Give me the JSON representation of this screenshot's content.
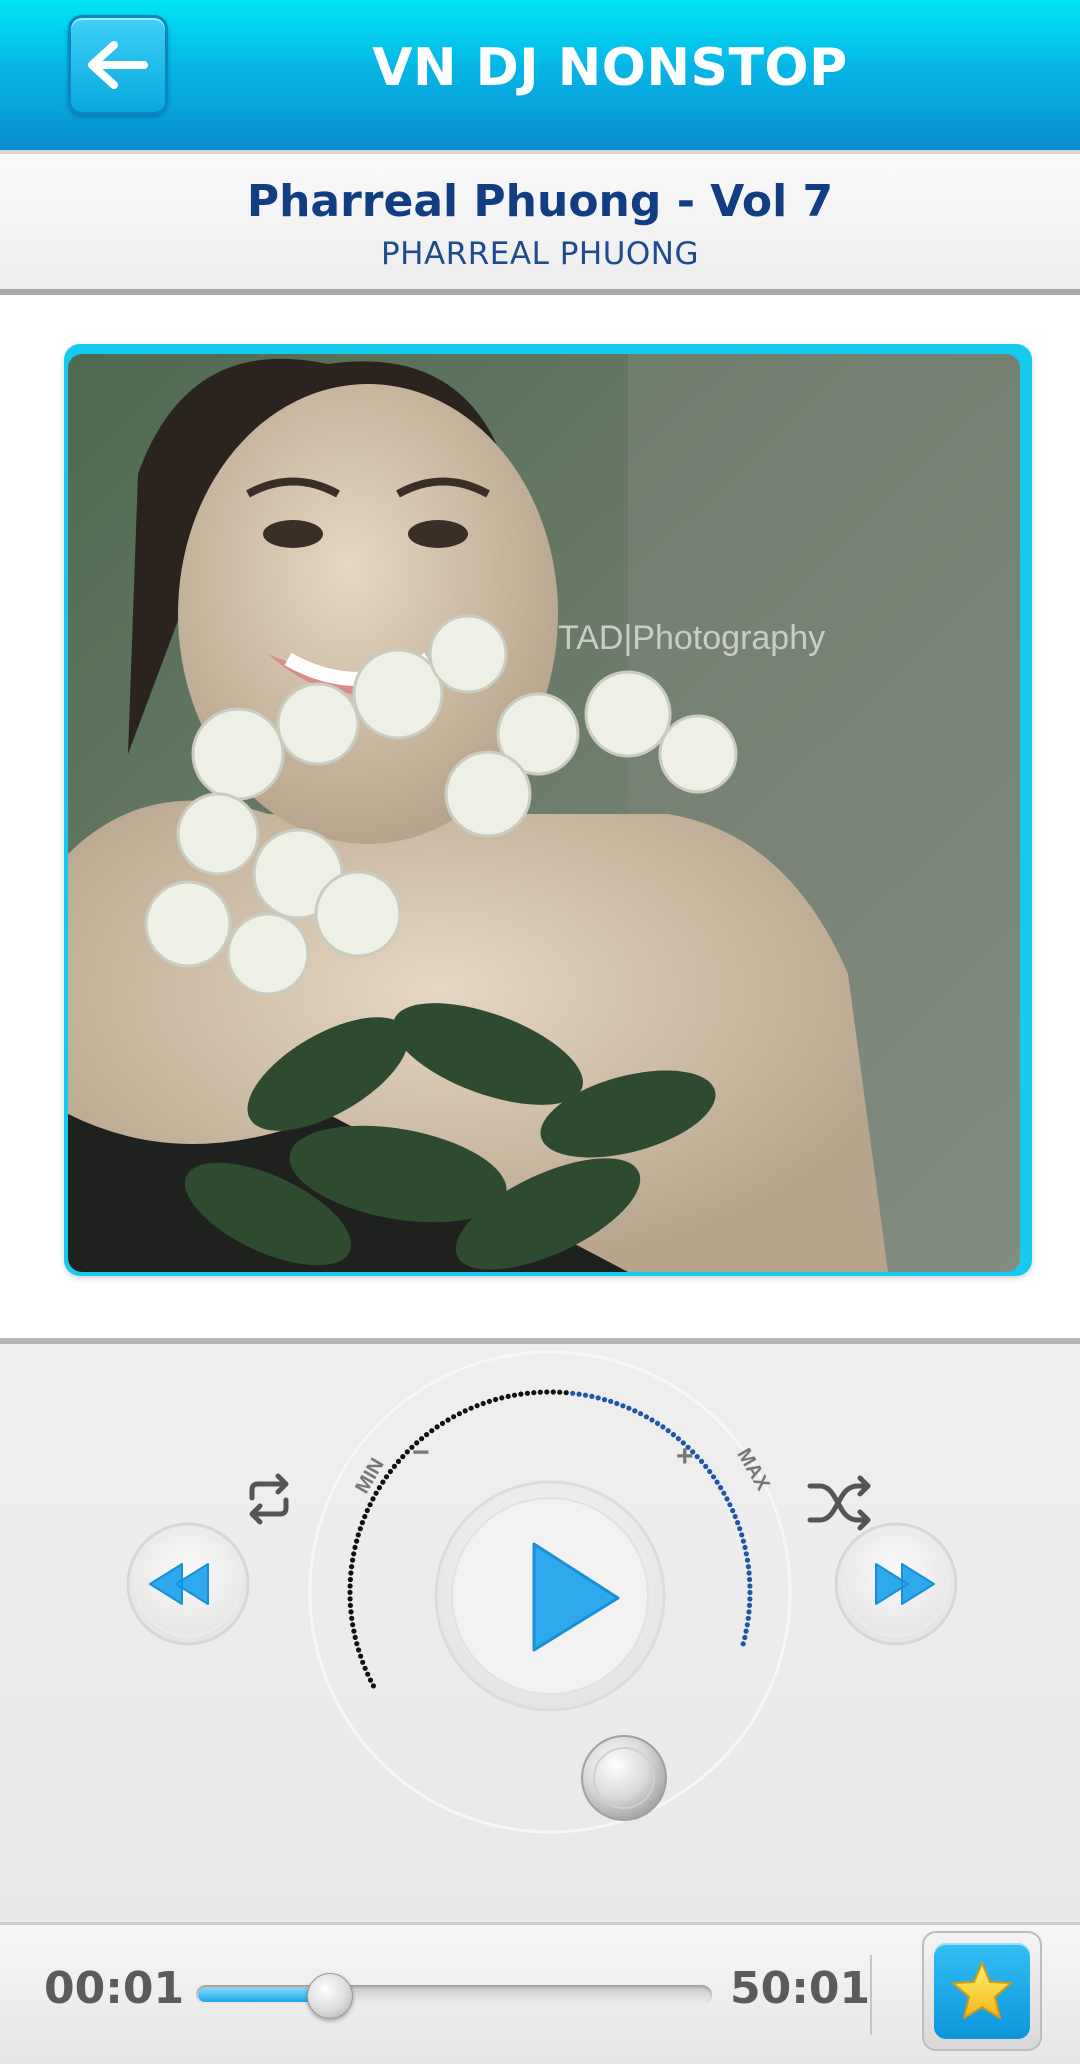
{
  "header": {
    "title": "VN DJ NONSTOP",
    "back_icon": "arrow-left-icon"
  },
  "track": {
    "title": "Pharreal Phuong - Vol 7",
    "artist": "PHARREAL PHUONG"
  },
  "artwork": {
    "watermark": "TAD|Photography"
  },
  "controls": {
    "volume_min_label": "MIN",
    "volume_max_label": "MAX",
    "volume_minus": "−",
    "volume_plus": "+",
    "volume_level": 0.55,
    "repeat_icon": "repeat-icon",
    "shuffle_icon": "shuffle-icon",
    "rewind_icon": "rewind-icon",
    "forward_icon": "fast-forward-icon",
    "play_icon": "play-icon"
  },
  "playback": {
    "elapsed": "00:01",
    "total": "50:01",
    "progress": 0.26
  },
  "favorite": {
    "icon": "star-icon"
  },
  "colors": {
    "accent": "#1aa8ec",
    "header": "#06b6e6",
    "title_text": "#123d82",
    "volume_low": "#1f56a8",
    "volume_high": "#111111"
  }
}
